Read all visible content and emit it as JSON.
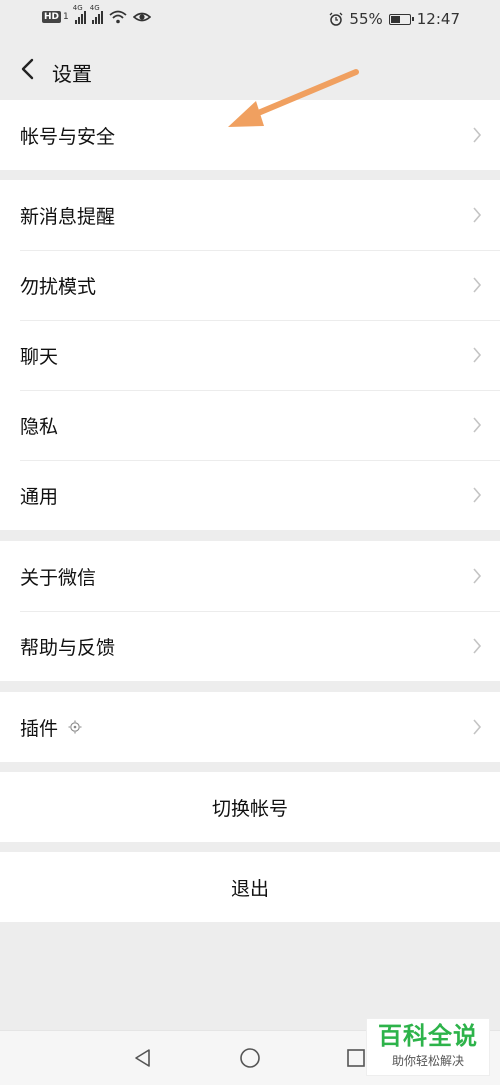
{
  "status_bar": {
    "left_badge": "HD",
    "left_badge_sub": "1",
    "signal1_tag": "4G",
    "signal2_tag": "4G",
    "battery_percent": "55%",
    "time": "12:47",
    "battery_level": 0.55
  },
  "header": {
    "title": "设置"
  },
  "groups": {
    "g1": [
      {
        "label": "帐号与安全"
      }
    ],
    "g2": [
      {
        "label": "新消息提醒"
      },
      {
        "label": "勿扰模式"
      },
      {
        "label": "聊天"
      },
      {
        "label": "隐私"
      },
      {
        "label": "通用"
      }
    ],
    "g3": [
      {
        "label": "关于微信"
      },
      {
        "label": "帮助与反馈"
      }
    ],
    "g4": [
      {
        "label": "插件"
      }
    ]
  },
  "actions": {
    "switch_account": "切换帐号",
    "logout": "退出"
  },
  "watermark": {
    "title": "百科全说",
    "subtitle": "助你轻松解决"
  },
  "colors": {
    "arrow": "#f0a060",
    "watermark_green": "#2db34a",
    "page_bg": "#ededed"
  }
}
